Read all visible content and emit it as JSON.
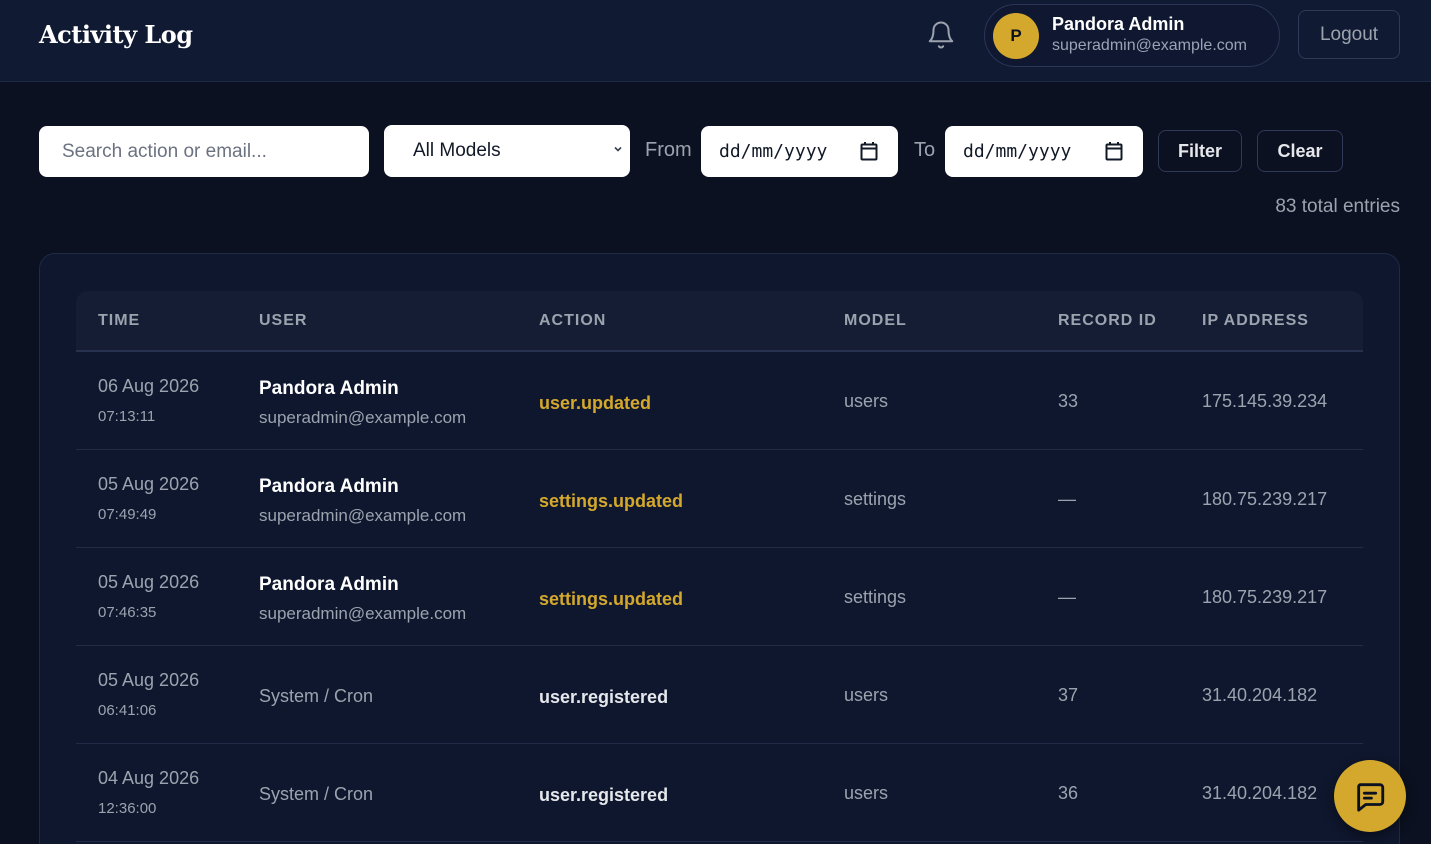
{
  "header": {
    "title": "Activity Log",
    "user_initial": "P",
    "user_name": "Pandora Admin",
    "user_email": "superadmin@example.com",
    "logout_label": "Logout",
    "bell_icon": "bell-icon"
  },
  "filters": {
    "search_placeholder": "Search action or email...",
    "search_value": "",
    "model_selected": "All Models",
    "from_label": "From",
    "from_placeholder": "dd/mm/yyyy",
    "to_label": "To",
    "to_placeholder": "dd/mm/yyyy",
    "filter_label": "Filter",
    "clear_label": "Clear",
    "total_text": "83 total entries"
  },
  "table": {
    "columns": [
      "TIME",
      "USER",
      "ACTION",
      "MODEL",
      "RECORD ID",
      "IP ADDRESS"
    ],
    "rows": [
      {
        "date": "06 Aug 2026",
        "time": "07:13:11",
        "user_name": "Pandora Admin",
        "user_email": "superadmin@example.com",
        "action": "user.updated",
        "model": "users",
        "record_id": "33",
        "ip": "175.145.39.234"
      },
      {
        "date": "05 Aug 2026",
        "time": "07:49:49",
        "user_name": "Pandora Admin",
        "user_email": "superadmin@example.com",
        "action": "settings.updated",
        "model": "settings",
        "record_id": "—",
        "ip": "180.75.239.217"
      },
      {
        "date": "05 Aug 2026",
        "time": "07:46:35",
        "user_name": "Pandora Admin",
        "user_email": "superadmin@example.com",
        "action": "settings.updated",
        "model": "settings",
        "record_id": "—",
        "ip": "180.75.239.217"
      },
      {
        "date": "05 Aug 2026",
        "time": "06:41:06",
        "user_system": "System / Cron",
        "action": "user.registered",
        "model": "users",
        "record_id": "37",
        "ip": "31.40.204.182"
      },
      {
        "date": "04 Aug 2026",
        "time": "12:36:00",
        "user_system": "System / Cron",
        "action": "user.registered",
        "model": "users",
        "record_id": "36",
        "ip": "31.40.204.182"
      }
    ]
  },
  "colors": {
    "accent": "#d4a82c",
    "background": "#0b1120",
    "header": "#111a33",
    "card": "#0f172e"
  },
  "chat_icon": "chat-bubble-icon"
}
